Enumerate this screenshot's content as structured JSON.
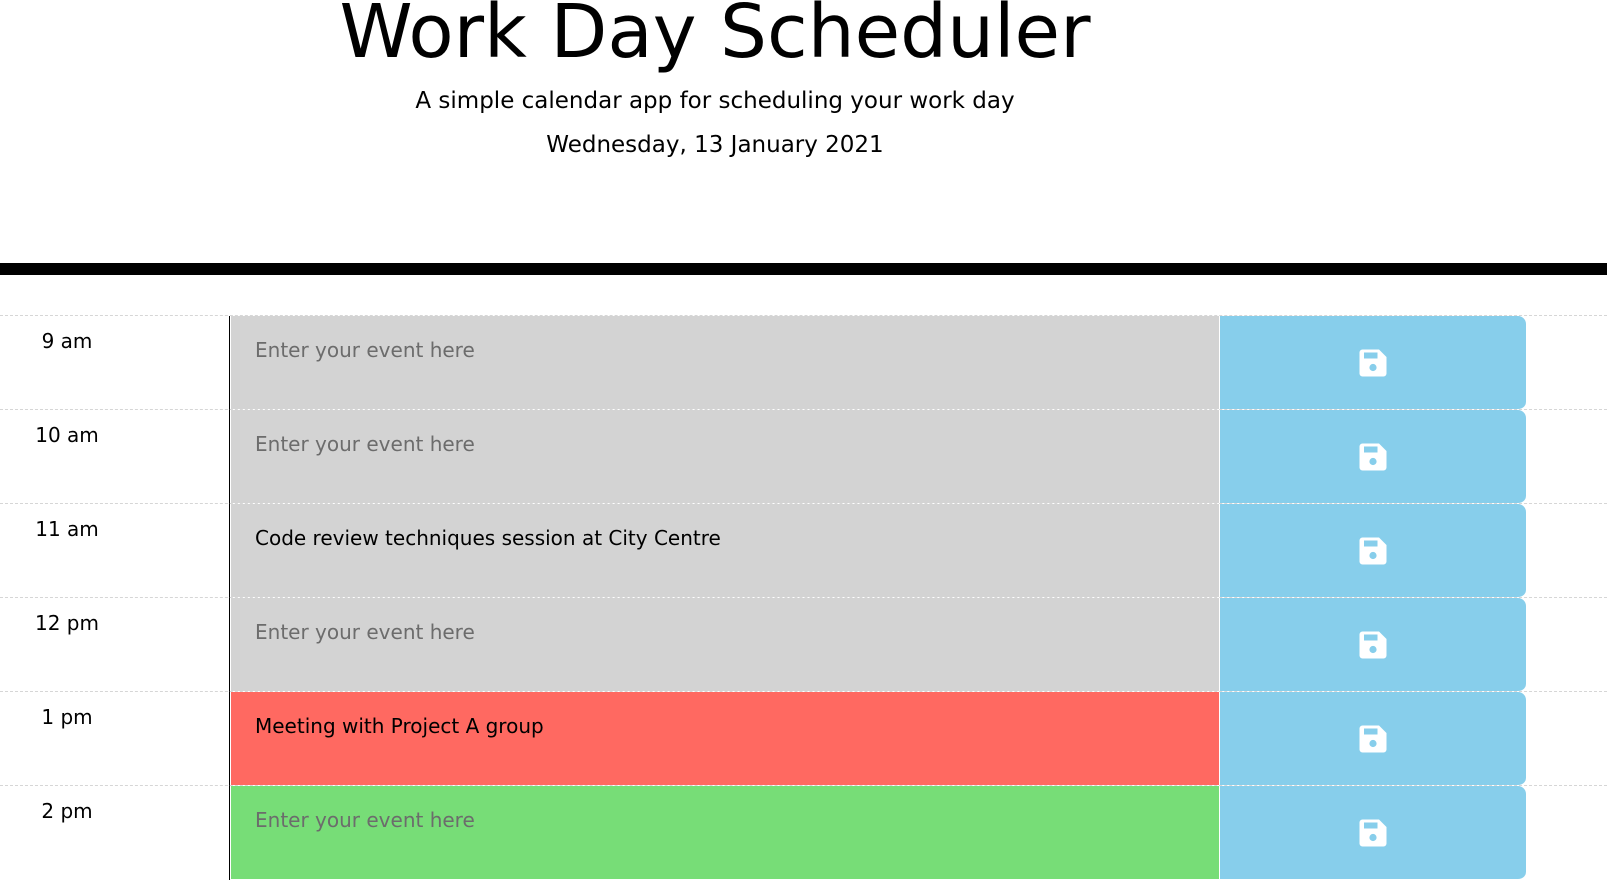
{
  "header": {
    "title": "Work Day Scheduler",
    "lead": "A simple calendar app for scheduling your work day",
    "current_day": "Wednesday, 13 January 2021"
  },
  "placeholder": "Enter your event here",
  "colors": {
    "past": "#d3d3d3",
    "present": "#ff6961",
    "future": "#77dd77",
    "save_button": "#87ceeb",
    "save_icon": "#ffffff"
  },
  "icons": {
    "save": "floppy-disk-icon"
  },
  "rows": [
    {
      "hour": "9 am",
      "event": "",
      "state": "past"
    },
    {
      "hour": "10 am",
      "event": "",
      "state": "past"
    },
    {
      "hour": "11 am",
      "event": "Code review techniques session at City Centre",
      "state": "past"
    },
    {
      "hour": "12 pm",
      "event": "",
      "state": "past"
    },
    {
      "hour": "1 pm",
      "event": "Meeting with Project A group",
      "state": "present"
    },
    {
      "hour": "2 pm",
      "event": "",
      "state": "future"
    }
  ]
}
